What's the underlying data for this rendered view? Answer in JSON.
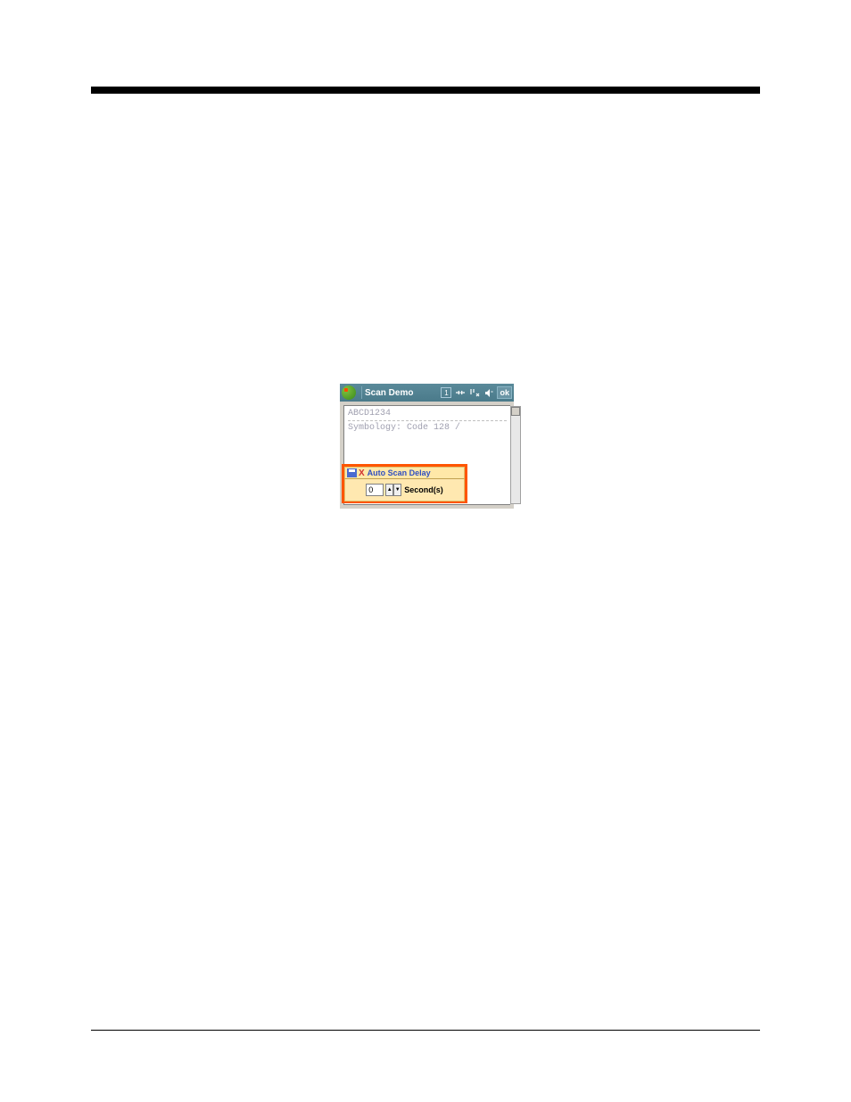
{
  "titlebar": {
    "title": "Scan Demo",
    "ok_label": "ok"
  },
  "content": {
    "line1": "ABCD1234",
    "line2": "Symbology: Code 128 /"
  },
  "popup": {
    "title": "Auto Scan Delay",
    "value": "0",
    "unit_label": "Second(s)"
  }
}
